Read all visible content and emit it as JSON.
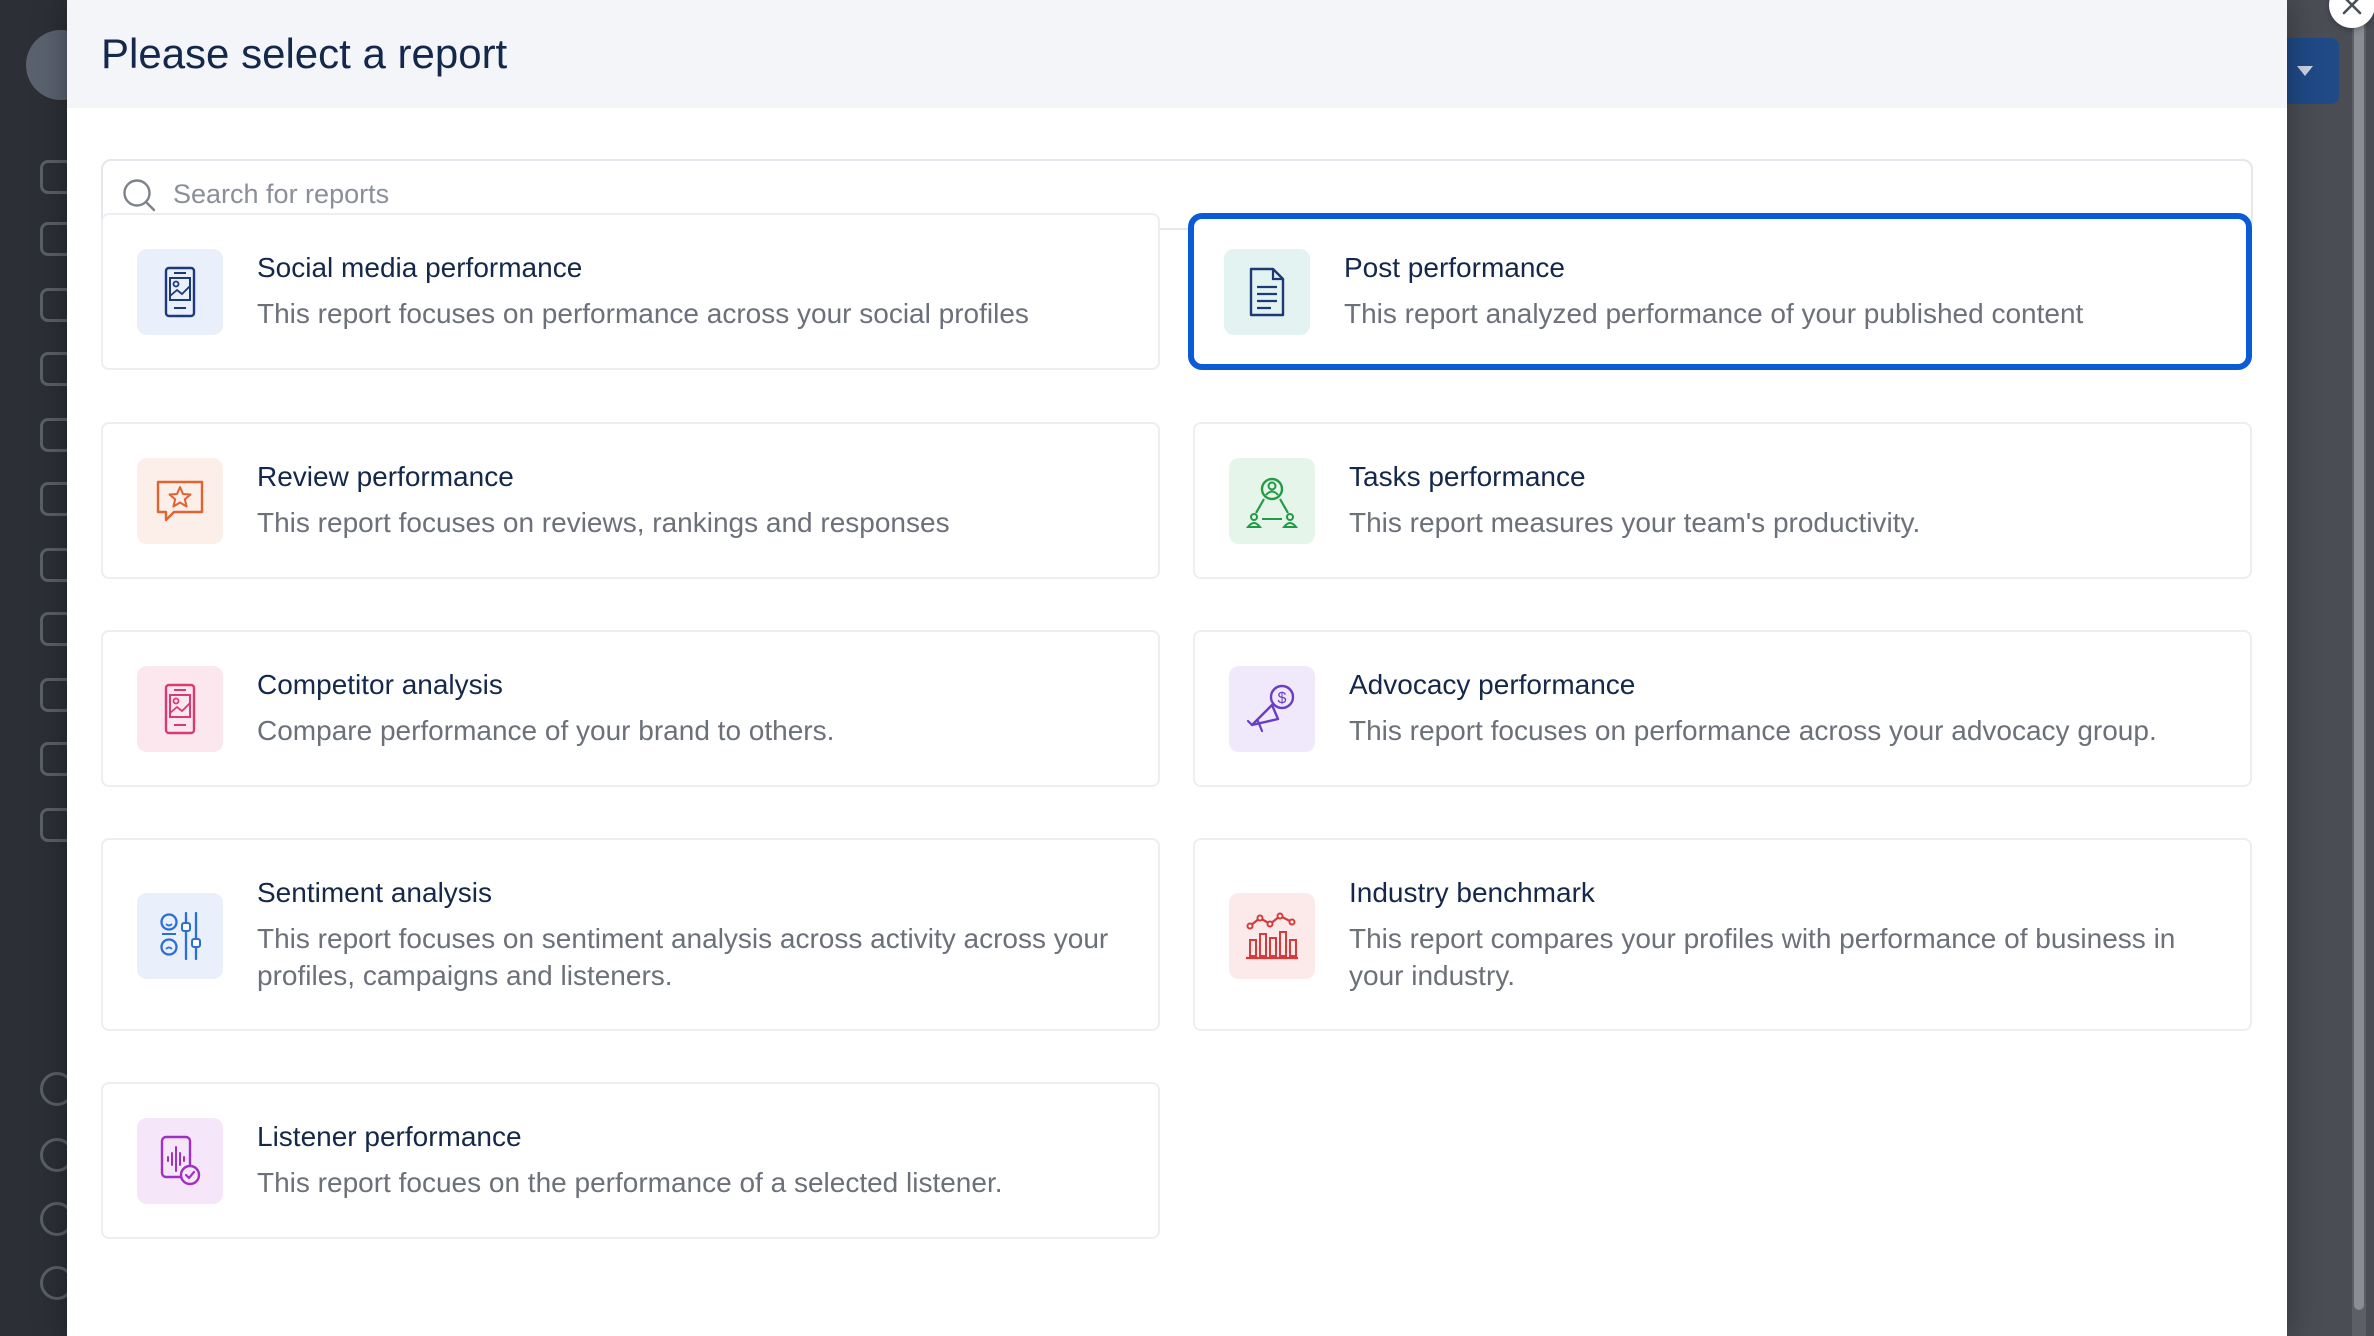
{
  "modal": {
    "title": "Please select a report",
    "close_icon": "close-icon"
  },
  "search": {
    "placeholder": "Search for reports",
    "value": ""
  },
  "colors": {
    "selected_border": "#0a5bd6",
    "title_text": "#14284b",
    "desc_text": "#6b7079"
  },
  "reports": [
    {
      "title": "Social media performance",
      "desc": "This report focuses on performance across your social profiles",
      "icon": "social-media-icon",
      "selected": false
    },
    {
      "title": "Post performance",
      "desc": "This report analyzed performance of your published content",
      "icon": "document-icon",
      "selected": true
    },
    {
      "title": "Review performance",
      "desc": "This report focuses on reviews, rankings and responses",
      "icon": "review-star-icon",
      "selected": false
    },
    {
      "title": "Tasks performance",
      "desc": "This report measures your team's productivity.",
      "icon": "team-icon",
      "selected": false
    },
    {
      "title": "Competitor analysis",
      "desc": "Compare performance of your brand to others.",
      "icon": "competitor-icon",
      "selected": false
    },
    {
      "title": "Advocacy performance",
      "desc": "This report focuses on performance across your advocacy group.",
      "icon": "megaphone-icon",
      "selected": false
    },
    {
      "title": "Sentiment analysis",
      "desc": "This report focuses on sentiment analysis across activity across your profiles, campaigns and listeners.",
      "icon": "sentiment-icon",
      "selected": false
    },
    {
      "title": "Industry benchmark",
      "desc": "This report compares your profiles with performance of business in your industry.",
      "icon": "benchmark-icon",
      "selected": false
    },
    {
      "title": "Listener performance",
      "desc": "This report focues on the performance of a selected listener.",
      "icon": "listener-icon",
      "selected": false
    }
  ]
}
